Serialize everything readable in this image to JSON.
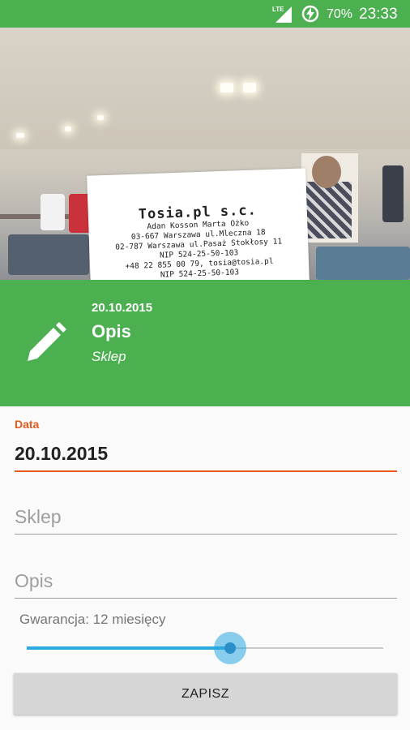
{
  "status_bar": {
    "network": "LTE",
    "battery": "70%",
    "time": "23:33",
    "icons": [
      "signal-icon",
      "battery-charging-icon"
    ]
  },
  "receipt_photo": {
    "title": "Tosia.pl s.c.",
    "lines": [
      "Adan Kosson Marta Ożko",
      "03-667 Warszawa ul.Mleczna 18",
      "02-787 Warszawa ul.Pasaż Stokłosy 11",
      "NIP 524-25-50-103",
      "+48 22 855 00 79, tosia@tosia.pl",
      "NIP 524-25-50-103"
    ]
  },
  "header": {
    "date": "20.10.2015",
    "description": "Opis",
    "shop": "Sklep",
    "icon": "pencil-icon"
  },
  "form": {
    "date_label": "Data",
    "date_value": "20.10.2015",
    "shop_placeholder": "Sklep",
    "description_placeholder": "Opis",
    "warranty_label": "Gwarancja: 12 miesięcy",
    "warranty_fraction": 0.57,
    "save_label": "ZAPISZ"
  },
  "colors": {
    "primary": "#4caf50",
    "accent": "#e65a1e",
    "slider": "#2aa8e0"
  }
}
